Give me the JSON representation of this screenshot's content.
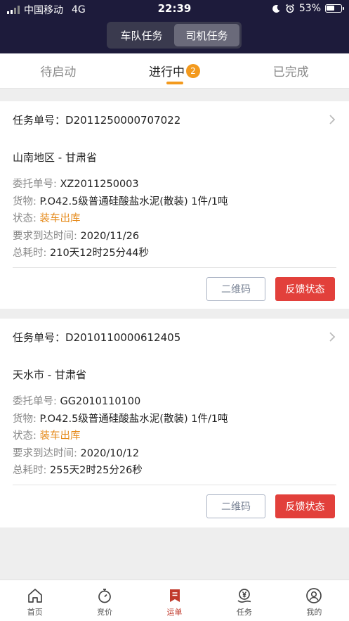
{
  "status_bar": {
    "carrier": "中国移动",
    "network": "4G",
    "time": "22:39",
    "battery": "53%"
  },
  "segment": [
    {
      "label": "车队任务",
      "active": false
    },
    {
      "label": "司机任务",
      "active": true
    }
  ],
  "tabs": [
    {
      "label": "待启动"
    },
    {
      "label": "进行中",
      "badge": "2"
    },
    {
      "label": "已完成"
    }
  ],
  "labels": {
    "task_no": "任务单号：",
    "consign_no": "委托单号:",
    "goods": "货物:",
    "status": "状态:",
    "arrive_time": "要求到达时间:",
    "total_time": "总耗时:",
    "qr_button": "二维码",
    "feedback_button": "反馈状态"
  },
  "cards": [
    {
      "task_no": "D2011250000707022",
      "region": "山南地区 - 甘肃省",
      "consign_no": "XZ2011250003",
      "goods": "P.O42.5级普通硅酸盐水泥(散装) 1件/1吨",
      "status": "装车出库",
      "arrive_time": "2020/11/26",
      "total_time": "210天12时25分44秒"
    },
    {
      "task_no": "D2010110000612405",
      "region": "天水市 - 甘肃省",
      "consign_no": "GG2010110100",
      "goods": "P.O42.5级普通硅酸盐水泥(散装) 1件/1吨",
      "status": "装车出库",
      "arrive_time": "2020/10/12",
      "total_time": "255天2时25分26秒"
    }
  ],
  "nav": [
    {
      "label": "首页",
      "icon": "home-icon"
    },
    {
      "label": "竞价",
      "icon": "stopwatch-icon"
    },
    {
      "label": "运单",
      "icon": "waybill-icon",
      "active": true
    },
    {
      "label": "任务",
      "icon": "task-yen-icon"
    },
    {
      "label": "我的",
      "icon": "user-icon"
    }
  ],
  "colors": {
    "header_bg": "#1d1b3b",
    "accent_orange": "#f39a1e",
    "feedback_red": "#e2403b",
    "nav_active": "#c0392b"
  }
}
